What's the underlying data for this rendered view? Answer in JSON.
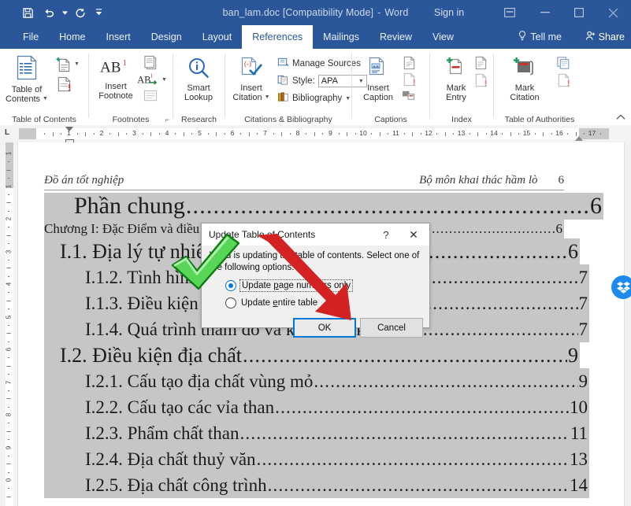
{
  "titlebar": {
    "document_name": "ban_lam.doc [Compatibility Mode]",
    "app_name": "Word",
    "compat_separator": "-",
    "signin": "Sign in",
    "quick_access": [
      {
        "name": "save-icon",
        "label": "Save"
      },
      {
        "name": "undo-icon",
        "label": "Undo"
      },
      {
        "name": "redo-icon",
        "label": "Redo"
      },
      {
        "name": "customize-quick-access-icon",
        "label": "Customize Quick Access Toolbar"
      }
    ],
    "window_controls": [
      {
        "name": "ribbon-display-options-icon",
        "label": "Ribbon Display Options"
      },
      {
        "name": "minimize-icon",
        "label": "Minimize"
      },
      {
        "name": "restore-icon",
        "label": "Restore Down"
      },
      {
        "name": "close-icon",
        "label": "Close"
      }
    ],
    "color": "#2b579a"
  },
  "tabs": [
    {
      "label": "File",
      "active": false
    },
    {
      "label": "Home",
      "active": false
    },
    {
      "label": "Insert",
      "active": false
    },
    {
      "label": "Design",
      "active": false
    },
    {
      "label": "Layout",
      "active": false
    },
    {
      "label": "References",
      "active": true
    },
    {
      "label": "Mailings",
      "active": false
    },
    {
      "label": "Review",
      "active": false
    },
    {
      "label": "View",
      "active": false
    }
  ],
  "tellme": "Tell me",
  "share": "Share",
  "ribbon": {
    "groups": [
      {
        "label": "Table of Contents"
      },
      {
        "label": "Footnotes"
      },
      {
        "label": "Research"
      },
      {
        "label": "Citations & Bibliography"
      },
      {
        "label": "Captions"
      },
      {
        "label": "Index"
      },
      {
        "label": "Table of Authorities"
      }
    ],
    "table_of_contents": {
      "button": "Table of\nContents",
      "line1": "Table of",
      "line2": "Contents",
      "add_text": "Add Text",
      "update_table": "Update Table"
    },
    "footnotes": {
      "line1": "Insert",
      "line2": "Footnote",
      "insert_endnote": "Insert Endnote",
      "next_footnote": "Next Footnote",
      "show_notes": "Show Notes"
    },
    "research": {
      "line1": "Smart",
      "line2": "Lookup"
    },
    "citations": {
      "line1": "Insert",
      "line2": "Citation",
      "manage_sources": "Manage Sources",
      "style_label": "Style:",
      "style_value": "APA",
      "bibliography": "Bibliography"
    },
    "captions": {
      "line1": "Insert",
      "line2": "Caption",
      "insert_table_of_figures": "Insert Table of Figures",
      "update_table": "Update Table",
      "cross_reference": "Cross-reference"
    },
    "index": {
      "line1": "Mark",
      "line2": "Entry",
      "insert_index": "Insert Index",
      "update_index": "Update Index"
    },
    "authorities": {
      "line1": "Mark",
      "line2": "Citation",
      "insert_toa": "Insert Table of Authorities",
      "update_table": "Update Table"
    },
    "collapse_label": "Collapse the Ribbon"
  },
  "rulers": {
    "horizontal_numbers": [
      1,
      2,
      3,
      4,
      5,
      6,
      7,
      8,
      9,
      10,
      11,
      12,
      13,
      14,
      15,
      16,
      17
    ],
    "vertical_numbers": [
      1,
      1,
      2,
      3,
      4,
      5,
      6,
      7,
      8,
      9,
      0
    ],
    "corner_tab": "L"
  },
  "document": {
    "header_left": "Đồ án tốt nghiệp",
    "header_right": "Bộ môn khai thác hầm lò",
    "header_page": "6",
    "toc": [
      {
        "text": "Phần chung ",
        "page": "6",
        "level": "lvl0"
      },
      {
        "text": "Chương I: Đặc Điểm và điều kiện địa chất khu mỏ",
        "page": "6",
        "level": "lvl-ch"
      },
      {
        "text": "I.1. Địa lý tự nhiên",
        "page": "6",
        "level": "lvl1"
      },
      {
        "text": "I.1.2.  Tình hình dân cư kinh tế và chính trị ",
        "page": "7",
        "level": "lvl2"
      },
      {
        "text": "I.1.3. Điều kiện khí hậu",
        "page": "7",
        "level": "lvl2"
      },
      {
        "text": "I.1.4. Quá trình thăm dò và khai thác khu mỏ ",
        "page": "7",
        "level": "lvl2"
      },
      {
        "text": "I.2. Điều kiện địa chất",
        "page": "9",
        "level": "lvl1"
      },
      {
        "text": "I.2.1. Cấu tạo địa chất vùng mỏ",
        "page": "9",
        "level": "lvl2"
      },
      {
        "text": "I.2.2. Cấu tạo các vỉa than ",
        "page": "10",
        "level": "lvl2"
      },
      {
        "text": "I.2.3. Phẩm chất than ",
        "page": "11",
        "level": "lvl2"
      },
      {
        "text": "I.2.4. Địa chất thuỷ văn",
        "page": "13",
        "level": "lvl2"
      },
      {
        "text": "I.2.5. Địa chất công trình",
        "page": "14",
        "level": "lvl2"
      }
    ],
    "leader_dots": "................................................................................................................"
  },
  "dialog": {
    "title": "Update Table of Contents",
    "help_glyph": "?",
    "close_glyph": "✕",
    "message": "Word is updating the table of contents.  Select one of the following options:",
    "options": [
      {
        "label_pre": "Update ",
        "label_u": "p",
        "label_post": "age numbers only",
        "selected": true
      },
      {
        "label_pre": "Update ",
        "label_u": "e",
        "label_post": "ntire table",
        "selected": false
      }
    ],
    "ok": "OK",
    "cancel": "Cancel",
    "accent": "#0078d7"
  },
  "annotations": {
    "check_color": "#1faa1f",
    "arrow_color": "#d42121"
  },
  "badge": {
    "name": "dropbox-icon",
    "color": "#1e8bec"
  }
}
